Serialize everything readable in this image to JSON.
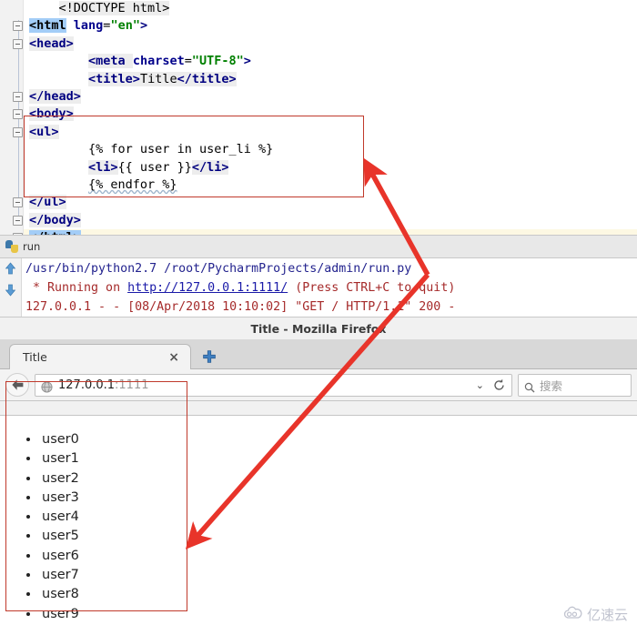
{
  "editor": {
    "lines": [
      {
        "indent": 1,
        "segments": [
          {
            "t": "<!DOCTYPE html>",
            "k": "plain"
          }
        ]
      },
      {
        "indent": 0,
        "fold": true,
        "segments": [
          {
            "t": "<html",
            "k": "sel"
          },
          {
            "t": " ",
            "k": "text"
          },
          {
            "t": "lang",
            "k": "attr"
          },
          {
            "t": "=",
            "k": "text"
          },
          {
            "t": "\"en\"",
            "k": "val"
          },
          {
            "t": ">",
            "k": "tagp"
          }
        ]
      },
      {
        "indent": 0,
        "fold": true,
        "segments": [
          {
            "t": "<head>",
            "k": "tag"
          }
        ]
      },
      {
        "indent": 2,
        "segments": [
          {
            "t": "<meta ",
            "k": "tag"
          },
          {
            "t": "charset",
            "k": "attr"
          },
          {
            "t": "=",
            "k": "text"
          },
          {
            "t": "\"UTF-8\"",
            "k": "val"
          },
          {
            "t": ">",
            "k": "tagp"
          }
        ]
      },
      {
        "indent": 2,
        "segments": [
          {
            "t": "<title>",
            "k": "tag"
          },
          {
            "t": "Title",
            "k": "plain"
          },
          {
            "t": "</title>",
            "k": "tag"
          }
        ]
      },
      {
        "indent": 0,
        "fold": true,
        "segments": [
          {
            "t": "</head>",
            "k": "tag"
          }
        ]
      },
      {
        "indent": 0,
        "fold": true,
        "segments": [
          {
            "t": "<body>",
            "k": "tag"
          }
        ]
      },
      {
        "indent": 0,
        "fold": true,
        "segments": [
          {
            "t": "<ul>",
            "k": "tag"
          }
        ]
      },
      {
        "indent": 2,
        "segments": [
          {
            "t": "{% for user in user_li %}",
            "k": "jinja"
          }
        ]
      },
      {
        "indent": 2,
        "segments": [
          {
            "t": "<li>",
            "k": "tag"
          },
          {
            "t": "{{ user }}",
            "k": "jinja"
          },
          {
            "t": "</li>",
            "k": "tag"
          }
        ]
      },
      {
        "indent": 2,
        "segments": [
          {
            "t": "{% endfor %}",
            "k": "squiggle"
          }
        ]
      },
      {
        "indent": 0,
        "fold": true,
        "segments": [
          {
            "t": "</ul>",
            "k": "tag"
          }
        ]
      },
      {
        "indent": 0,
        "fold": true,
        "segments": [
          {
            "t": "</body>",
            "k": "tag"
          }
        ]
      },
      {
        "indent": 0,
        "fold": true,
        "current": true,
        "segments": [
          {
            "t": "</html>",
            "k": "sel"
          }
        ]
      }
    ]
  },
  "console": {
    "tab_label": "run",
    "lines": [
      {
        "kind": "cmd",
        "parts": [
          {
            "t": "/usr/bin/python2.7 /root/PycharmProjects/admin/run.py",
            "k": "plain"
          }
        ]
      },
      {
        "kind": "err",
        "parts": [
          {
            "t": " * Running on ",
            "k": "plain"
          },
          {
            "t": "http://127.0.0.1:1111/",
            "k": "link"
          },
          {
            "t": " (Press CTRL+C to quit)",
            "k": "plain"
          }
        ]
      },
      {
        "kind": "err",
        "parts": [
          {
            "t": "127.0.0.1 - - [08/Apr/2018 10:10:02] \"GET / HTTP/1.1\" 200 -",
            "k": "plain"
          }
        ]
      }
    ]
  },
  "browser": {
    "window_title": "Title - Mozilla Firefox",
    "tab_title": "Title",
    "tab_close_glyph": "×",
    "url_host": "127.0.0.1",
    "url_port": ":1111",
    "search_placeholder": "搜索",
    "chevron_glyph": "⌄",
    "users": [
      "user0",
      "user1",
      "user2",
      "user3",
      "user4",
      "user5",
      "user6",
      "user7",
      "user8",
      "user9"
    ]
  },
  "watermark": {
    "text": "亿速云"
  },
  "colors": {
    "annotation_red": "#e8342a",
    "box_red": "#c0392b",
    "tag_blue": "#000080",
    "attr_value_green": "#008000",
    "console_cmd": "#23238e",
    "console_err": "#a52a2a"
  }
}
